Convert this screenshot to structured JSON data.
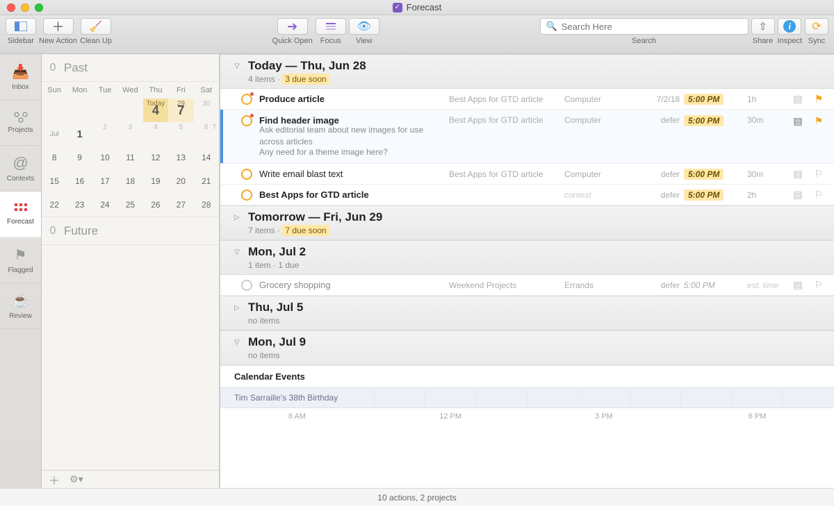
{
  "window": {
    "title": "Forecast"
  },
  "toolbar": {
    "sidebar": "Sidebar",
    "new_action": "New Action",
    "clean_up": "Clean Up",
    "quick_open": "Quick Open",
    "focus": "Focus",
    "view": "View",
    "search_placeholder": "Search Here",
    "search_label": "Search",
    "share": "Share",
    "inspect": "Inspect",
    "sync": "Sync"
  },
  "nav": {
    "inbox": "Inbox",
    "projects": "Projects",
    "contexts": "Contexts",
    "forecast": "Forecast",
    "flagged": "Flagged",
    "review": "Review"
  },
  "forecast_sidebar": {
    "past_count": "0",
    "past_label": "Past",
    "future_count": "0",
    "future_label": "Future",
    "dow": [
      "Sun",
      "Mon",
      "Tue",
      "Wed",
      "Thu",
      "Fri",
      "Sat"
    ],
    "today_label": "Today",
    "today_num": "4",
    "fri_num": "7",
    "fri_small": "29",
    "sat_small": "30",
    "month_label": "Jul",
    "week2": [
      "",
      "1",
      "",
      "",
      "",
      "",
      ""
    ],
    "week2_small": [
      "",
      "",
      "2",
      "3",
      "4",
      "5",
      "6",
      "7"
    ],
    "week3": [
      "8",
      "9",
      "10",
      "11",
      "12",
      "13",
      "14"
    ],
    "week4": [
      "15",
      "16",
      "17",
      "18",
      "19",
      "20",
      "21"
    ],
    "week5": [
      "22",
      "23",
      "24",
      "25",
      "26",
      "27",
      "28"
    ]
  },
  "sections": {
    "today": {
      "title": "Today — Thu, Jun 28",
      "sub_items": "4 items · ",
      "sub_due": "3 due soon"
    },
    "tomorrow": {
      "title": "Tomorrow — Fri, Jun 29",
      "sub_items": "7 items · ",
      "sub_due": "7 due soon"
    },
    "jul2": {
      "title": "Mon, Jul 2",
      "sub": "1 item · 1 due"
    },
    "jul5": {
      "title": "Thu, Jul 5",
      "sub": "no items"
    },
    "jul9": {
      "title": "Mon, Jul 9",
      "sub": "no items"
    },
    "cal_events": "Calendar Events"
  },
  "tasks": {
    "t1": {
      "title": "Produce article",
      "project": "Best Apps for GTD article",
      "context": "Computer",
      "date": "7/2/18",
      "time": "5:00 PM",
      "est": "1h"
    },
    "t2": {
      "title": "Find header image",
      "project": "Best Apps for GTD article",
      "context": "Computer",
      "date": "defer",
      "time": "5:00 PM",
      "est": "30m",
      "note1": "Ask editorial team about new images for use across articles",
      "note2": "Any need for a theme image here?"
    },
    "t3": {
      "title": "Write email blast text",
      "project": "Best Apps for GTD article",
      "context": "Computer",
      "date": "defer",
      "time": "5:00 PM",
      "est": "30m"
    },
    "t4": {
      "title": "Best Apps for GTD article",
      "project": "",
      "context": "context",
      "date": "defer",
      "time": "5:00 PM",
      "est": "2h"
    },
    "t5": {
      "title": "Grocery shopping",
      "project": "Weekend Projects",
      "context": "Errands",
      "date": "defer",
      "time": "5:00 PM",
      "est": "est. time"
    }
  },
  "timeline": {
    "event": "Tim Sarraille's 38th Birthday",
    "hours": [
      "8 AM",
      "12 PM",
      "3 PM",
      "6 PM"
    ]
  },
  "statusbar": "10 actions, 2 projects"
}
